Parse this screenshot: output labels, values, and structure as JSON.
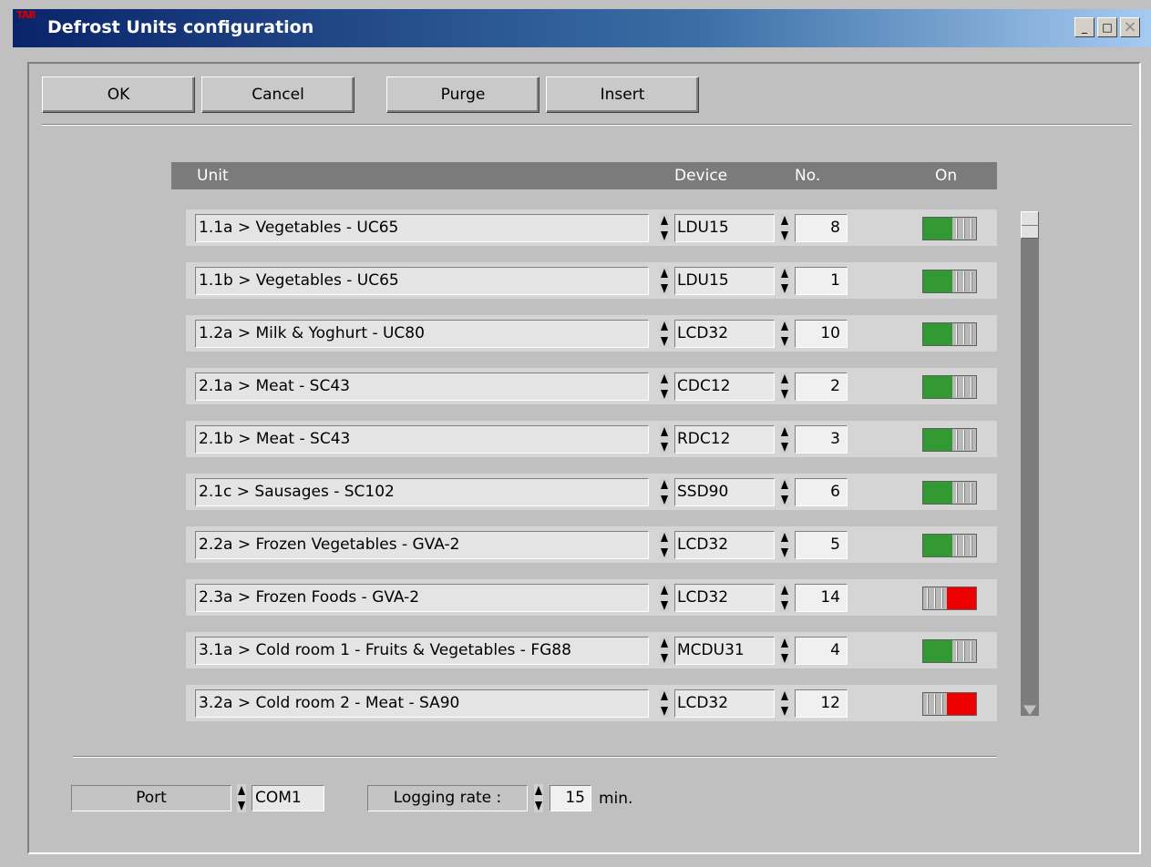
{
  "window": {
    "title": "Defrost Units configuration",
    "logo_text": "TAB",
    "controls": {
      "minimize": "_",
      "maximize": "□",
      "close": "×"
    }
  },
  "toolbar": {
    "ok_label": "OK",
    "cancel_label": "Cancel",
    "purge_label": "Purge",
    "insert_label": "Insert"
  },
  "table": {
    "headers": {
      "unit": "Unit",
      "device": "Device",
      "no": "No.",
      "on": "On"
    },
    "rows": [
      {
        "unit": "1.1a > Vegetables - UC65",
        "device": "LDU15",
        "no": "8",
        "on": true
      },
      {
        "unit": "1.1b > Vegetables - UC65",
        "device": "LDU15",
        "no": "1",
        "on": true
      },
      {
        "unit": "1.2a > Milk & Yoghurt - UC80",
        "device": "LCD32",
        "no": "10",
        "on": true
      },
      {
        "unit": "2.1a > Meat - SC43",
        "device": "CDC12",
        "no": "2",
        "on": true
      },
      {
        "unit": "2.1b > Meat - SC43",
        "device": "RDC12",
        "no": "3",
        "on": true
      },
      {
        "unit": "2.1c > Sausages - SC102",
        "device": "SSD90",
        "no": "6",
        "on": true
      },
      {
        "unit": "2.2a > Frozen Vegetables - GVA-2",
        "device": "LCD32",
        "no": "5",
        "on": true
      },
      {
        "unit": "2.3a > Frozen Foods - GVA-2",
        "device": "LCD32",
        "no": "14",
        "on": false
      },
      {
        "unit": "3.1a > Cold room 1 - Fruits & Vegetables - FG88",
        "device": "MCDU31",
        "no": "4",
        "on": true
      },
      {
        "unit": "3.2a > Cold room 2 - Meat - SA90",
        "device": "LCD32",
        "no": "12",
        "on": false
      }
    ]
  },
  "footer": {
    "port_label": "Port",
    "port_value": "COM1",
    "logging_label": "Logging rate :",
    "logging_value": "15",
    "logging_unit": "min."
  },
  "colors": {
    "on": "#339933",
    "off": "#ee0000",
    "header_bg": "#7b7b7b",
    "title_gradient_start": "#0a246a"
  },
  "icons": {
    "spinner": "spinner-arrows-icon",
    "toggle_on": "toggle-on-icon",
    "toggle_off": "toggle-off-icon"
  }
}
